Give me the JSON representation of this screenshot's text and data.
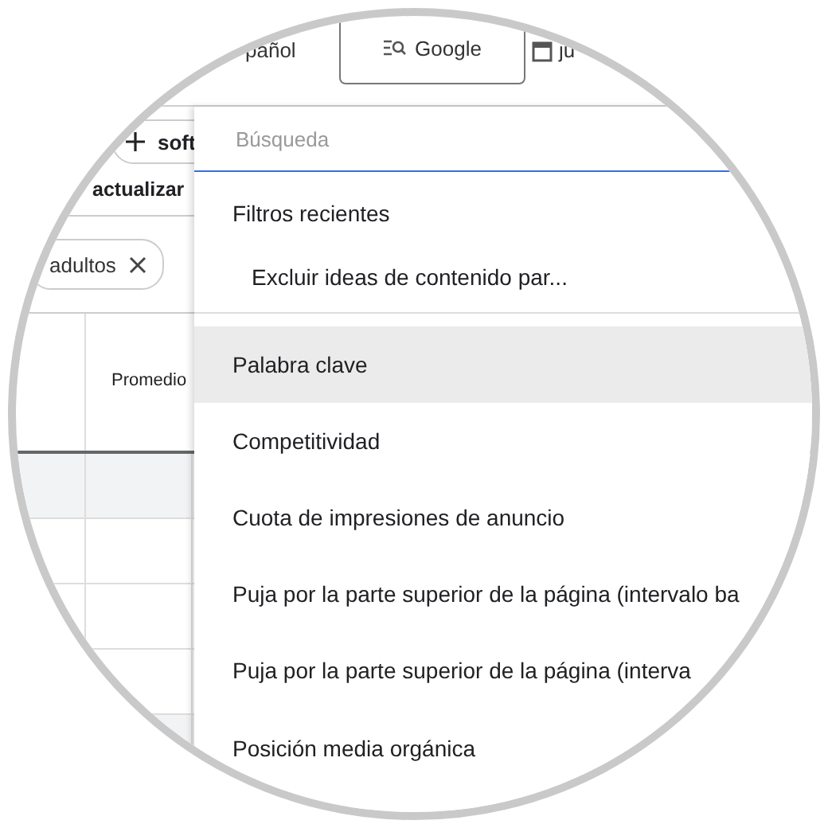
{
  "top_bar": {
    "language": "pañol",
    "network_tab": {
      "label": "Google",
      "selected": true
    },
    "date": "ju"
  },
  "filters": {
    "add_chip": "soft",
    "refine_link": "actualizar",
    "applied_chip": "adultos"
  },
  "table": {
    "columns": [
      "Promedio"
    ]
  },
  "dropdown": {
    "search": {
      "placeholder": "Búsqueda"
    },
    "recent_heading": "Filtros recientes",
    "recent": [
      {
        "label": "Excluir ideas de contenido par..."
      }
    ],
    "items": [
      {
        "label": "Palabra clave",
        "selected": true
      },
      {
        "label": "Competitividad",
        "selected": false
      },
      {
        "label": "Cuota de impresiones de anuncio",
        "selected": false
      },
      {
        "label": "Puja por la parte superior de la página (intervalo ba",
        "selected": false
      },
      {
        "label": "Puja por la parte superior de la página (interva",
        "selected": false
      },
      {
        "label": "Posición media orgánica",
        "selected": false
      }
    ]
  }
}
